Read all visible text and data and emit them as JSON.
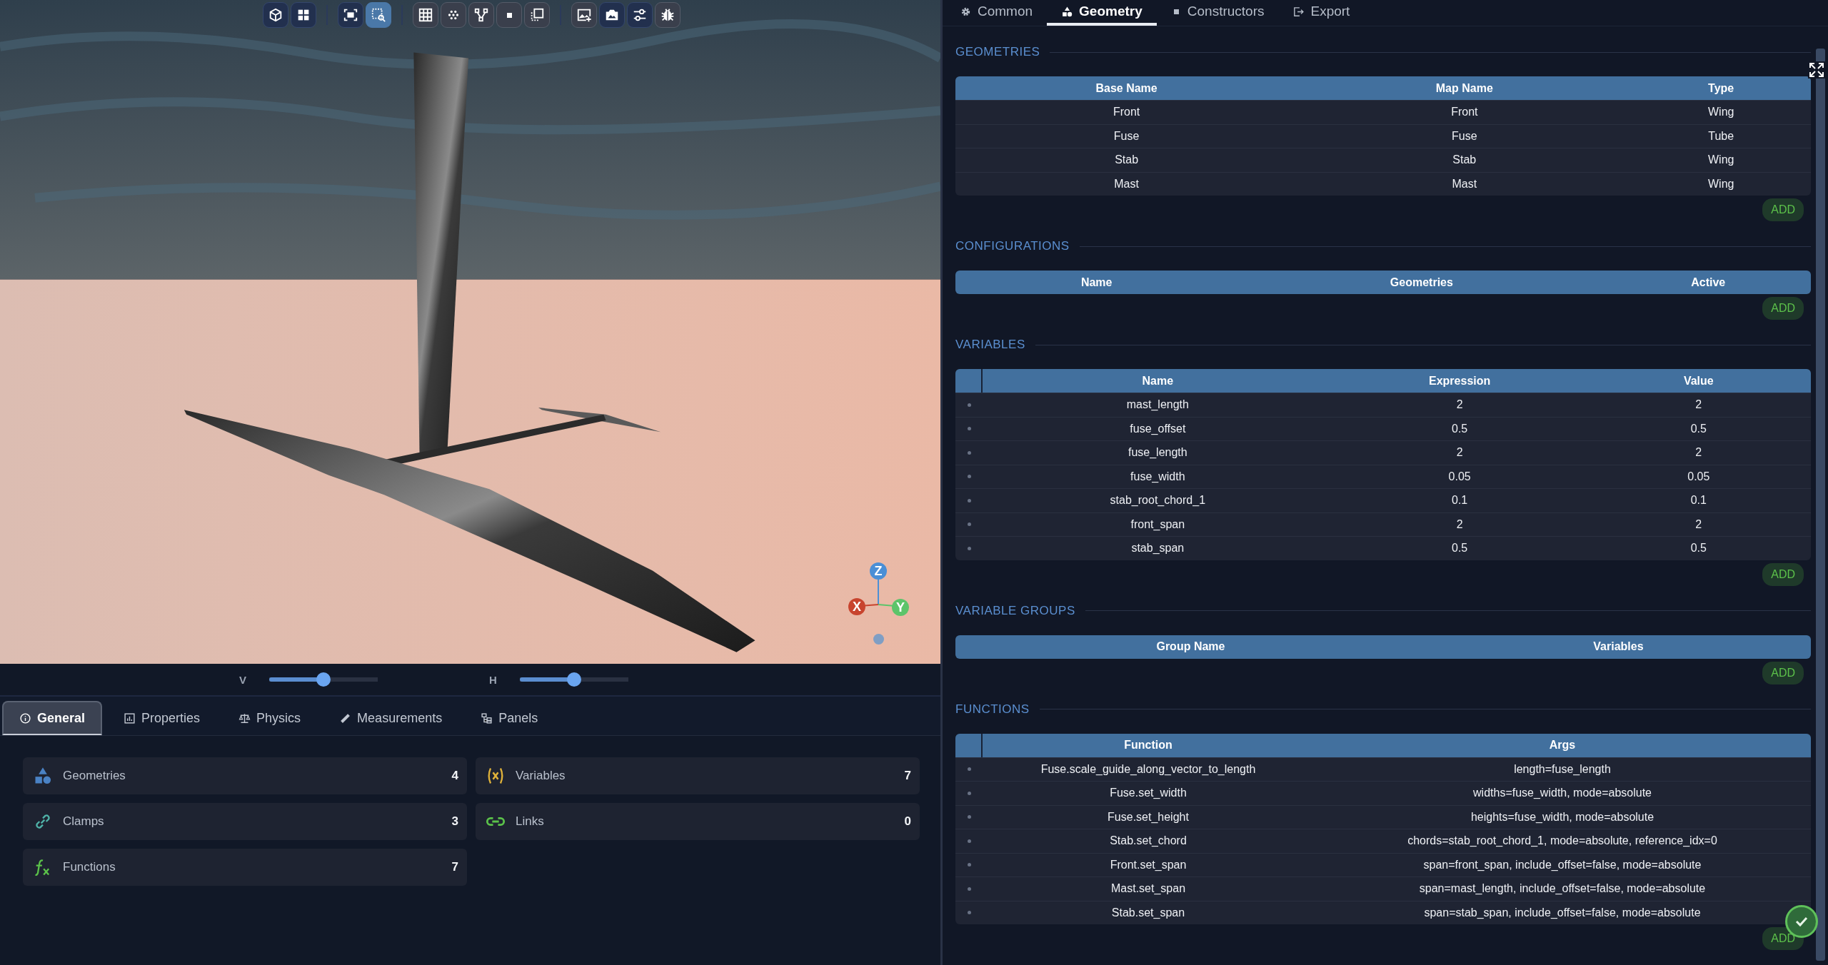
{
  "toolbar": {
    "groups": [
      [
        {
          "selected": false,
          "highlighted": true
        },
        {
          "selected": false,
          "highlighted": true
        }
      ],
      [
        {
          "selected": false,
          "highlighted": true
        },
        {
          "selected": true,
          "highlighted": false
        }
      ],
      [
        {
          "selected": false,
          "highlighted": false
        },
        {
          "selected": false,
          "highlighted": false
        },
        {
          "selected": false,
          "highlighted": false
        },
        {
          "selected": false,
          "highlighted": false
        },
        {
          "selected": false,
          "highlighted": false
        }
      ],
      [
        {
          "selected": false,
          "highlighted": false
        },
        {
          "selected": false,
          "highlighted": true
        },
        {
          "selected": false,
          "highlighted": true
        },
        {
          "selected": false,
          "highlighted": false
        }
      ]
    ]
  },
  "axis_gizmo": {
    "z": "Z",
    "x": "X",
    "y": "Y"
  },
  "sliders": [
    {
      "label": "V",
      "level": 0.5
    },
    {
      "label": "H",
      "level": 0.5
    }
  ],
  "bottom_tabs": [
    {
      "label": "General",
      "selected": true
    },
    {
      "label": "Properties",
      "selected": false
    },
    {
      "label": "Physics",
      "selected": false
    },
    {
      "label": "Measurements",
      "selected": false
    },
    {
      "label": "Panels",
      "selected": false
    }
  ],
  "summary_cards": [
    {
      "label": "Geometries",
      "count": "4"
    },
    {
      "label": "Variables",
      "count": "7"
    },
    {
      "label": "Clamps",
      "count": "3"
    },
    {
      "label": "Links",
      "count": "0"
    },
    {
      "label": "Functions",
      "count": "7"
    }
  ],
  "right_tabs": [
    {
      "label": "Common",
      "selected": false
    },
    {
      "label": "Geometry",
      "selected": true
    },
    {
      "label": "Constructors",
      "selected": false
    },
    {
      "label": "Export",
      "selected": false
    }
  ],
  "sections": [
    {
      "title": "GEOMETRIES",
      "handles": false,
      "columns": [
        "Base Name",
        "Map Name",
        "Type"
      ],
      "rows": [
        [
          "Front",
          "Front",
          "Wing"
        ],
        [
          "Fuse",
          "Fuse",
          "Tube"
        ],
        [
          "Stab",
          "Stab",
          "Wing"
        ],
        [
          "Mast",
          "Mast",
          "Wing"
        ]
      ],
      "add_label": "ADD"
    },
    {
      "title": "CONFIGURATIONS",
      "handles": false,
      "columns": [
        "Name",
        "Geometries",
        "Active"
      ],
      "add_label": "ADD"
    },
    {
      "title": "VARIABLES",
      "handles": true,
      "columns": [
        "Name",
        "Expression",
        "Value"
      ],
      "rows": [
        [
          "mast_length",
          "2",
          "2"
        ],
        [
          "fuse_offset",
          "0.5",
          "0.5"
        ],
        [
          "fuse_length",
          "2",
          "2"
        ],
        [
          "fuse_width",
          "0.05",
          "0.05"
        ],
        [
          "stab_root_chord_1",
          "0.1",
          "0.1"
        ],
        [
          "front_span",
          "2",
          "2"
        ],
        [
          "stab_span",
          "0.5",
          "0.5"
        ]
      ],
      "add_label": "ADD"
    },
    {
      "title": "VARIABLE GROUPS",
      "handles": false,
      "columns": [
        "Group Name",
        "Variables"
      ],
      "add_label": "ADD"
    },
    {
      "title": "FUNCTIONS",
      "handles": true,
      "columns": [
        "Function",
        "Args"
      ],
      "rows": [
        [
          "Fuse.scale_guide_along_vector_to_length",
          "length=fuse_length"
        ],
        [
          "Fuse.set_width",
          "widths=fuse_width, mode=absolute"
        ],
        [
          "Fuse.set_height",
          "heights=fuse_width, mode=absolute"
        ],
        [
          "Stab.set_chord",
          "chords=stab_root_chord_1, mode=absolute, reference_idx=0"
        ],
        [
          "Front.set_span",
          "span=front_span, include_offset=false, mode=absolute"
        ],
        [
          "Mast.set_span",
          "span=mast_length, include_offset=false, mode=absolute"
        ],
        [
          "Stab.set_span",
          "span=stab_span, include_offset=false, mode=absolute"
        ]
      ],
      "add_label": "ADD"
    }
  ]
}
